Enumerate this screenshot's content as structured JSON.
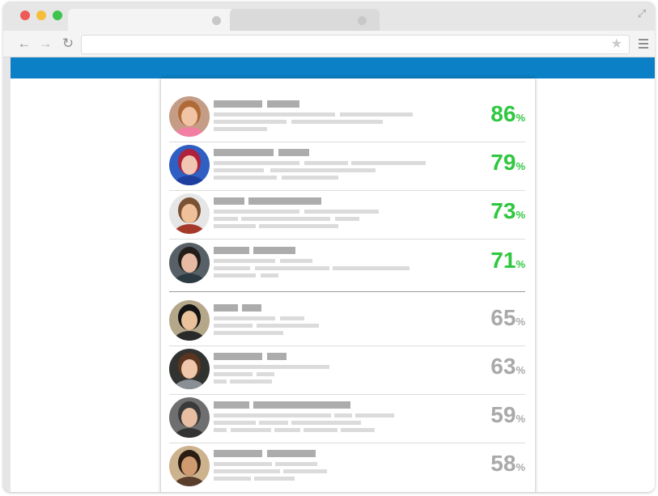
{
  "colors": {
    "banner": "#0b80c6",
    "high_score": "#2fc73f",
    "low_score": "#a9a9a9"
  },
  "icons": {
    "back": "arrow-left",
    "forward": "arrow-right",
    "reload": "reload",
    "bookmark": "star",
    "menu": "hamburger",
    "expand": "expand-arrows"
  },
  "ranking": {
    "candidates": [
      {
        "score": "86",
        "unit": "%",
        "tier": "high"
      },
      {
        "score": "79",
        "unit": "%",
        "tier": "high"
      },
      {
        "score": "73",
        "unit": "%",
        "tier": "high"
      },
      {
        "score": "71",
        "unit": "%",
        "tier": "high"
      },
      {
        "score": "65",
        "unit": "%",
        "tier": "low"
      },
      {
        "score": "63",
        "unit": "%",
        "tier": "low"
      },
      {
        "score": "59",
        "unit": "%",
        "tier": "low"
      },
      {
        "score": "58",
        "unit": "%",
        "tier": "low"
      }
    ]
  }
}
